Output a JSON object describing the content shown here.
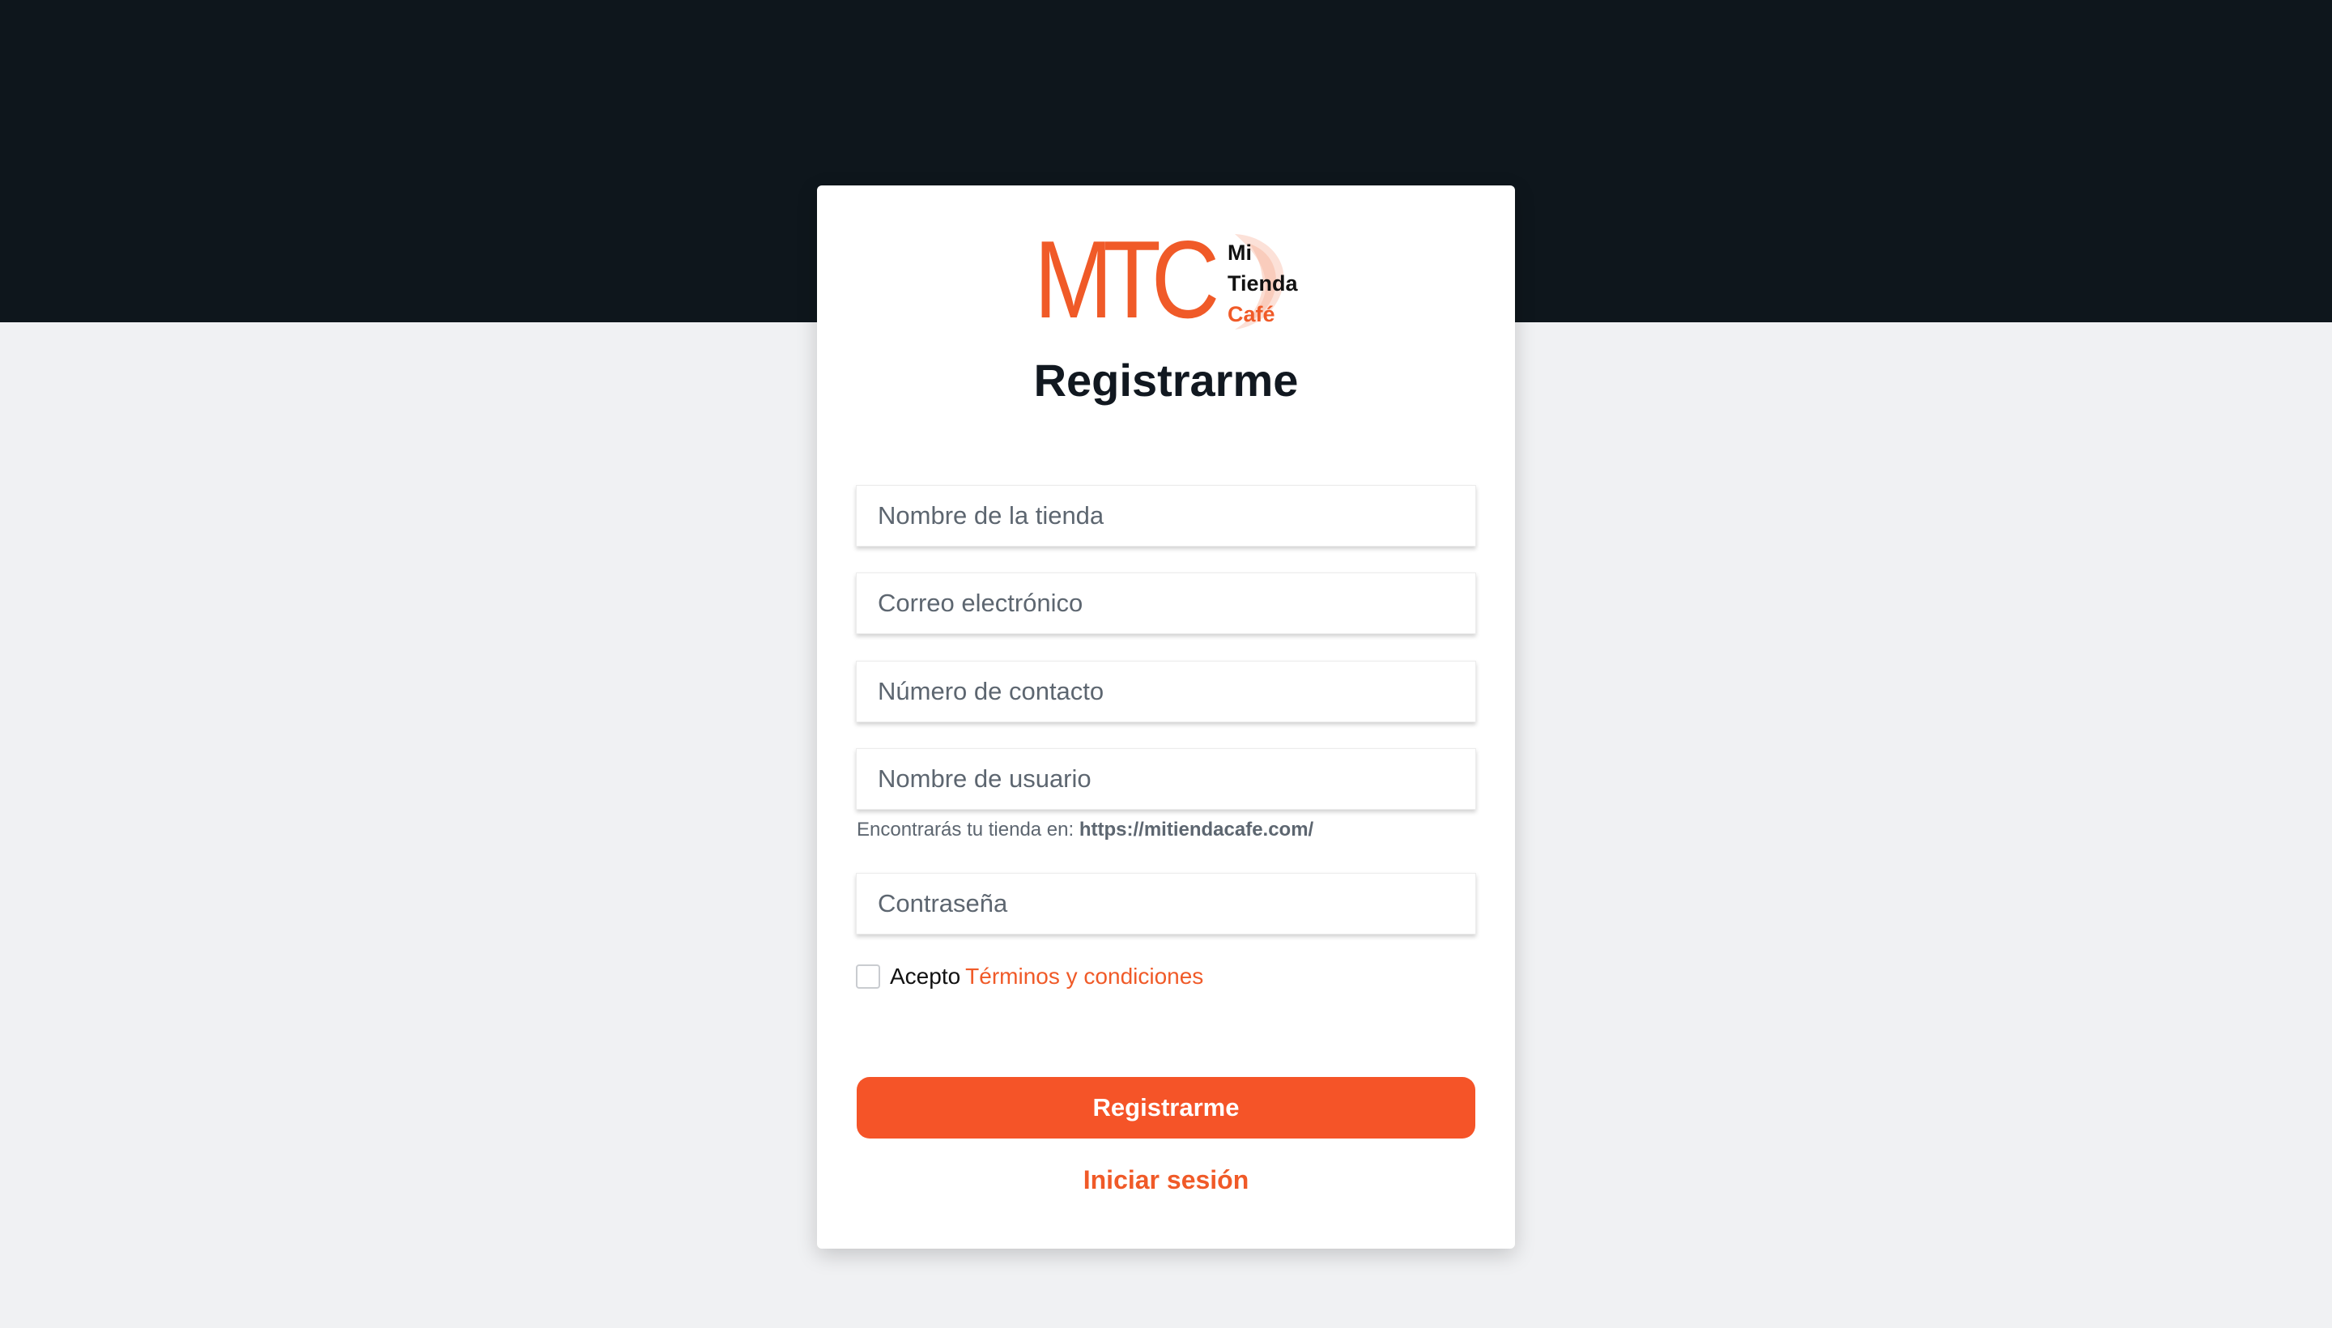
{
  "logo": {
    "mark": "MTC",
    "line1": "Mi",
    "line2": "Tienda",
    "line3": "Café"
  },
  "form": {
    "title": "Registrarme",
    "fields": {
      "store_name": {
        "placeholder": "Nombre de la tienda",
        "value": ""
      },
      "email": {
        "placeholder": "Correo electrónico",
        "value": ""
      },
      "phone": {
        "placeholder": "Número de contacto",
        "value": ""
      },
      "username": {
        "placeholder": "Nombre de usuario",
        "value": ""
      },
      "password": {
        "placeholder": "Contraseña",
        "value": ""
      }
    },
    "hint_prefix": "Encontrarás tu tienda en:",
    "hint_url": "https://mitiendacafe.com/",
    "accept_label": "Acepto",
    "terms_link": "Términos y condiciones",
    "terms_checked": false,
    "submit_label": "Registrarme",
    "login_link": "Iniciar sesión"
  },
  "colors": {
    "accent": "#f55428",
    "header_band": "#0e161c",
    "background": "#f0f1f3"
  }
}
